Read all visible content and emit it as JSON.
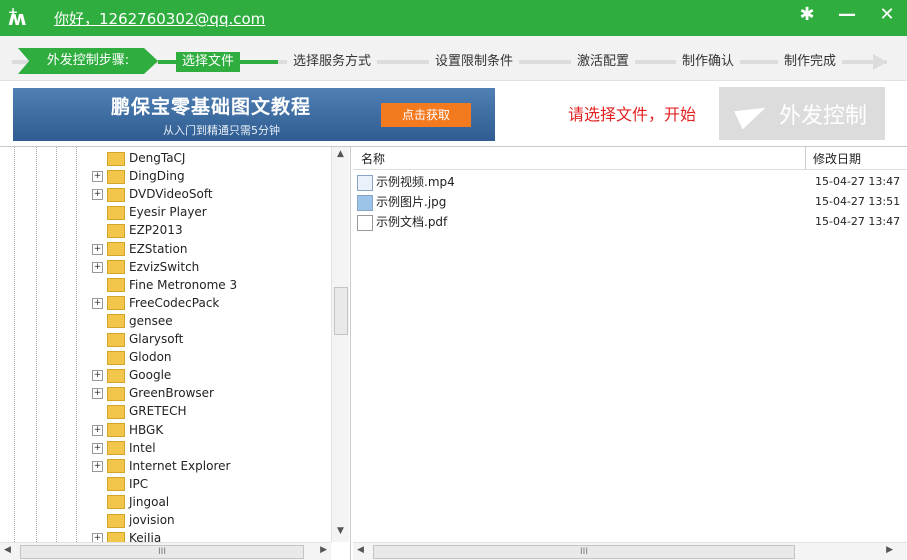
{
  "header": {
    "greeting": "你好，1262760302@qq.com",
    "window_buttons": [
      "gear-icon",
      "minimize-icon",
      "close-icon"
    ]
  },
  "steps": {
    "lead_label": "外发控制步骤:",
    "items": [
      "选择文件",
      "选择服务方式",
      "设置限制条件",
      "激活配置",
      "制作确认",
      "制作完成"
    ],
    "active_index": 0
  },
  "banner": {
    "title": "鹏保宝零基础图文教程",
    "subtitle": "从入门到精通只需5分钟",
    "cta_label": "点击获取"
  },
  "hint_text": "请选择文件，开始",
  "send_button_label": "外发控制",
  "tree": {
    "items": [
      {
        "label": "DengTaCJ",
        "expandable": false
      },
      {
        "label": "DingDing",
        "expandable": true
      },
      {
        "label": "DVDVideoSoft",
        "expandable": true
      },
      {
        "label": "Eyesir Player",
        "expandable": false
      },
      {
        "label": "EZP2013",
        "expandable": false
      },
      {
        "label": "EZStation",
        "expandable": true
      },
      {
        "label": "EzvizSwitch",
        "expandable": true
      },
      {
        "label": "Fine Metronome 3",
        "expandable": false
      },
      {
        "label": "FreeCodecPack",
        "expandable": true
      },
      {
        "label": "gensee",
        "expandable": false
      },
      {
        "label": "Glarysoft",
        "expandable": false
      },
      {
        "label": "Glodon",
        "expandable": false
      },
      {
        "label": "Google",
        "expandable": true
      },
      {
        "label": "GreenBrowser",
        "expandable": true
      },
      {
        "label": "GRETECH",
        "expandable": false
      },
      {
        "label": "HBGK",
        "expandable": true
      },
      {
        "label": "Intel",
        "expandable": true
      },
      {
        "label": "Internet Explorer",
        "expandable": true
      },
      {
        "label": "IPC",
        "expandable": false
      },
      {
        "label": "Jingoal",
        "expandable": false
      },
      {
        "label": "jovision",
        "expandable": false
      },
      {
        "label": "KeiJia",
        "expandable": true
      }
    ]
  },
  "file_list": {
    "columns": [
      "名称",
      "修改日期"
    ],
    "rows": [
      {
        "name": "示例视频.mp4",
        "date": "15-04-27 13:47",
        "icon": "video-file-icon"
      },
      {
        "name": "示例图片.jpg",
        "date": "15-04-27 13:51",
        "icon": "image-file-icon"
      },
      {
        "name": "示例文档.pdf",
        "date": "15-04-27 13:47",
        "icon": "pdf-file-icon"
      }
    ]
  },
  "scroll_grip": "III",
  "colors": {
    "brand_green": "#2fae3f",
    "hint_red": "#e42222",
    "cta_orange": "#f47a20"
  }
}
